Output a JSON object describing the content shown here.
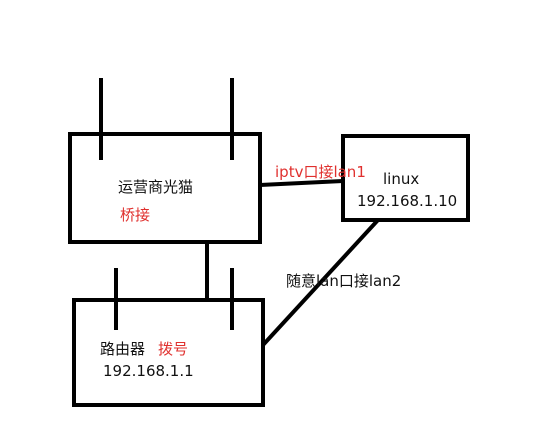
{
  "modem": {
    "title": "运营商光猫",
    "mode": "桥接"
  },
  "linux_box": {
    "title": "linux",
    "ip": "192.168.1.10"
  },
  "router": {
    "title": "路由器",
    "mode": "拨号",
    "ip": "192.168.1.1"
  },
  "links": {
    "modem_to_linux": "iptv口接lan1",
    "linux_to_router": "随意lan口接lan2"
  },
  "colors": {
    "stroke": "#000000",
    "accent_red": "#e0302e",
    "text": "#111111",
    "background": "#ffffff"
  }
}
